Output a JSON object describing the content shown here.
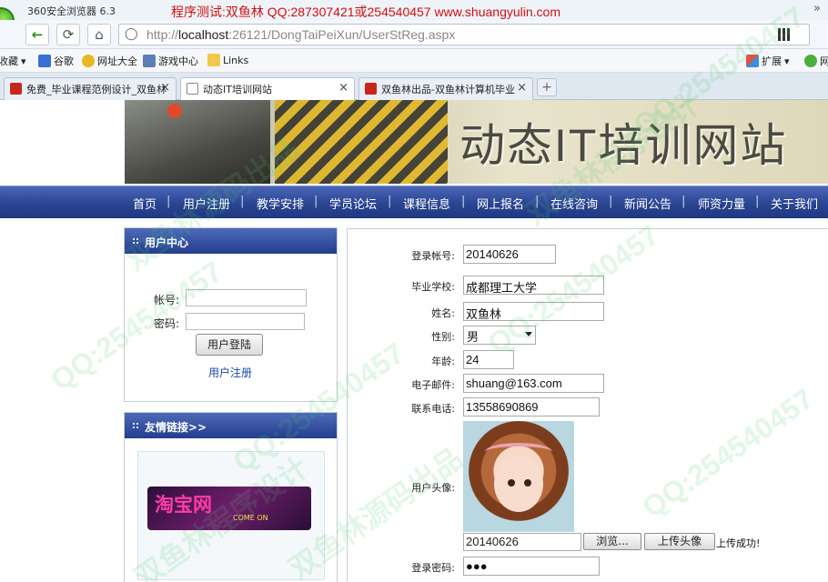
{
  "browser": {
    "app_title": "360安全浏览器 6.3",
    "banner": "程序测试:双鱼林 QQ:287307421或254540457 www.shuangyulin.com",
    "url_prefix": "http://",
    "url_host": "localhost",
    "url_rest": ":26121/DongTaiPeiXun/UserStReg.aspx",
    "close_glyph": "»",
    "favorites": [
      "收藏",
      "谷歌",
      "网址大全",
      "游戏中心",
      "Links"
    ],
    "right_tools": [
      "扩展",
      "网"
    ],
    "tabs": [
      {
        "label": "免费_毕业课程范例设计_双鱼林"
      },
      {
        "label": "动态IT培训网站"
      },
      {
        "label": "双鱼林出品-双鱼林计算机毕业"
      }
    ],
    "new_tab": "+"
  },
  "site": {
    "header_title": "动态IT培训网站",
    "menu": [
      "首页",
      "用户注册",
      "教学安排",
      "学员论坛",
      "课程信息",
      "网上报名",
      "在线咨询",
      "新闻公告",
      "师资力量",
      "关于我们"
    ]
  },
  "user_center": {
    "title": "用户中心",
    "account_label": "帐号:",
    "password_label": "密码:",
    "login_button": "用户登陆",
    "register_link": "用户注册"
  },
  "friend_links": {
    "title": "友情链接>>",
    "taobao_text": "淘宝网",
    "taobao_sub": "COME ON"
  },
  "form": {
    "fields": {
      "account": {
        "label": "登录帐号:",
        "value": "20140626"
      },
      "school": {
        "label": "毕业学校:",
        "value": "成都理工大学"
      },
      "name": {
        "label": "姓名:",
        "value": "双鱼林"
      },
      "gender": {
        "label": "性别:",
        "value": "男"
      },
      "age": {
        "label": "年龄:",
        "value": "24"
      },
      "email": {
        "label": "电子邮件:",
        "value": "shuang@163.com"
      },
      "phone": {
        "label": "联系电话:",
        "value": "13558690869"
      },
      "avatar": {
        "label": "用户头像:"
      },
      "password": {
        "label": "登录密码:",
        "value": "●●●"
      }
    },
    "file_value": "20140626",
    "browse_button": "浏览...",
    "upload_button": "上传头像",
    "upload_message": "上传成功!"
  },
  "watermark": {
    "qq": "QQ:254540457",
    "brand1": "双鱼林源码出品",
    "brand2": "双鱼林程序设计"
  },
  "colors": {
    "menu_blue": "#2a4592",
    "banner_red": "#d01010",
    "watermark_green": "#50c86e"
  }
}
